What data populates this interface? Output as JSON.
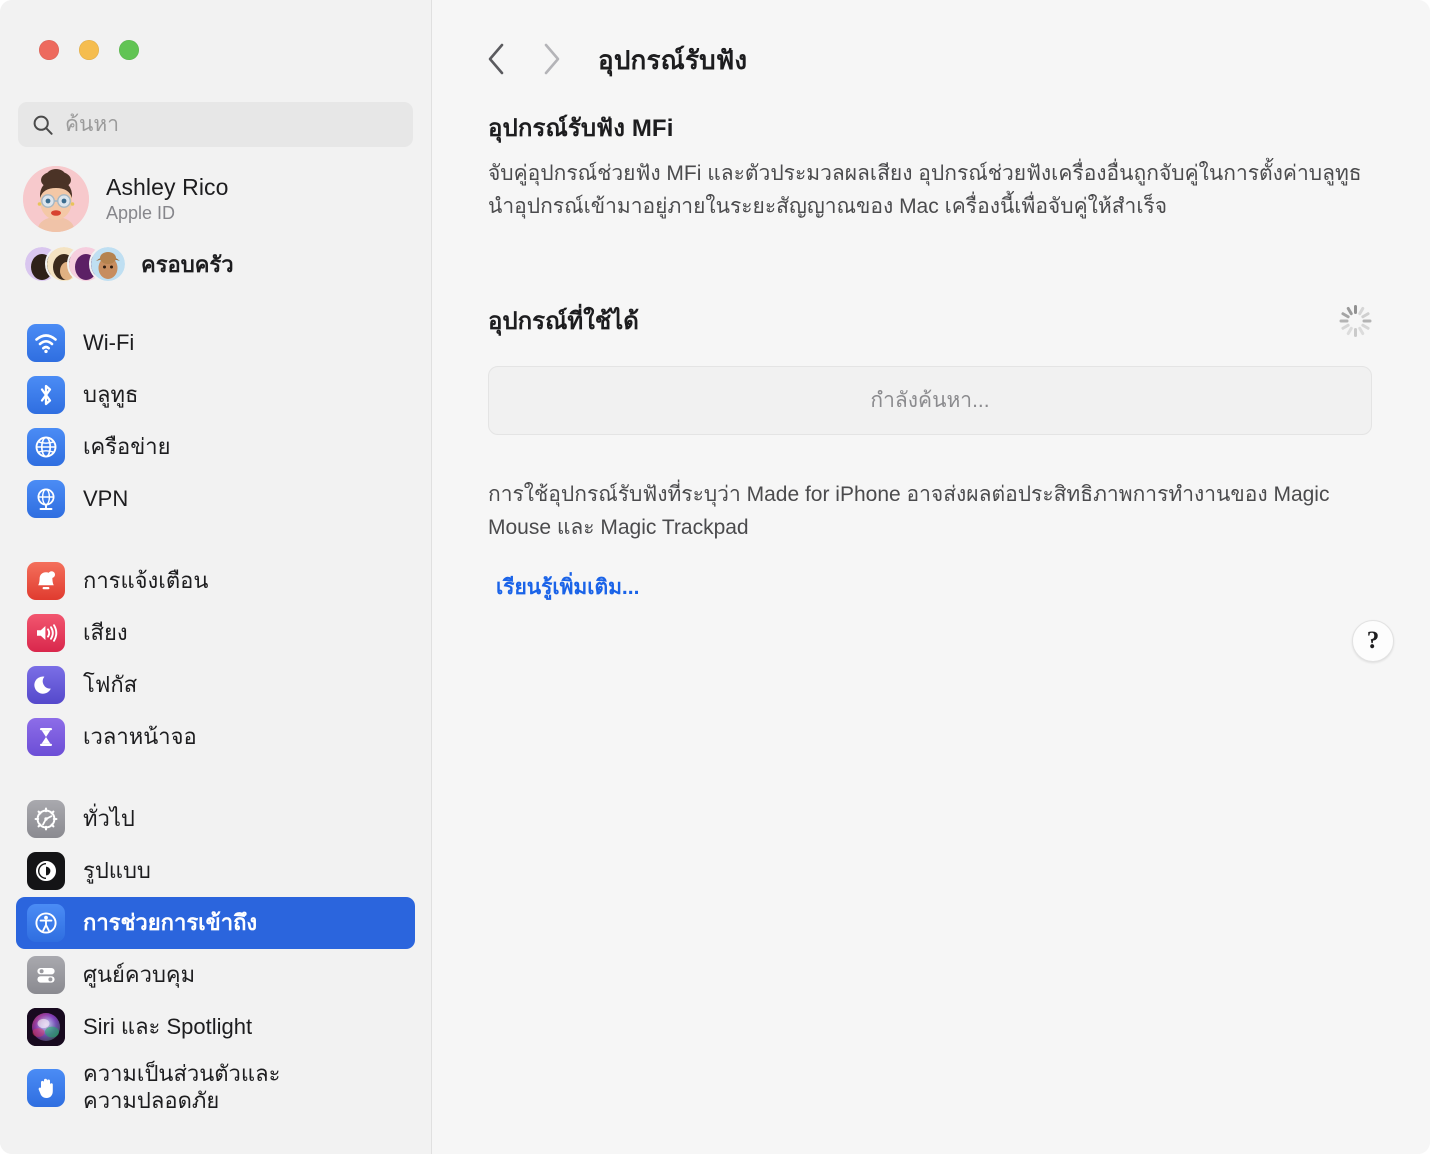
{
  "window": {
    "traffic_lights": [
      {
        "name": "close",
        "color": "#ED6A5E"
      },
      {
        "name": "minimize",
        "color": "#F5BD4F"
      },
      {
        "name": "maximize",
        "color": "#61C454"
      }
    ]
  },
  "sidebar": {
    "search": {
      "placeholder": "ค้นหา",
      "value": "",
      "icon": "search-icon"
    },
    "account": {
      "name": "Ashley Rico",
      "subtitle": "Apple ID",
      "avatar": "memoji-avatar"
    },
    "family": {
      "label": "ครอบครัว",
      "avatar_count": 4
    },
    "groups": [
      {
        "items": [
          {
            "label": "Wi-Fi",
            "icon": "wifi-icon",
            "color": "#3b7ef0",
            "selected": false
          },
          {
            "label": "บลูทูธ",
            "icon": "bluetooth-icon",
            "color": "#3b7ef0",
            "selected": false
          },
          {
            "label": "เครือข่าย",
            "icon": "globe-icon",
            "color": "#3b7ef0",
            "selected": false
          },
          {
            "label": "VPN",
            "icon": "vpn-globe-icon",
            "color": "#3b7ef0",
            "selected": false
          }
        ]
      },
      {
        "items": [
          {
            "label": "การแจ้งเตือน",
            "icon": "bell-icon",
            "color": "#ef4a3c",
            "selected": false
          },
          {
            "label": "เสียง",
            "icon": "speaker-icon",
            "color": "#e8365a",
            "selected": false
          },
          {
            "label": "โฟกัส",
            "icon": "moon-icon",
            "color": "#6458d8",
            "selected": false
          },
          {
            "label": "เวลาหน้าจอ",
            "icon": "hourglass-icon",
            "color": "#7a5ede",
            "selected": false
          }
        ]
      },
      {
        "items": [
          {
            "label": "ทั่วไป",
            "icon": "gear-icon",
            "color": "#8e8e93",
            "selected": false
          },
          {
            "label": "รูปแบบ",
            "icon": "appearance-icon",
            "color": "#1c1c1e",
            "selected": false
          },
          {
            "label": "การช่วยการเข้าถึง",
            "icon": "accessibility-icon",
            "color": "#2b65dd",
            "selected": true
          },
          {
            "label": "ศูนย์ควบคุม",
            "icon": "control-center-icon",
            "color": "#8e8e93",
            "selected": false
          },
          {
            "label": "Siri และ Spotlight",
            "icon": "siri-icon",
            "color": "#2a1630",
            "selected": false
          },
          {
            "label": "ความเป็นส่วนตัวและความปลอดภัย",
            "icon": "privacy-hand-icon",
            "color": "#3b7ef0",
            "selected": true,
            "two_line": true,
            "line1": "ความเป็นส่วนตัวและ",
            "line2": "ความปลอดภัย"
          }
        ]
      }
    ],
    "selected_accent": "#2B65DD"
  },
  "main": {
    "nav": {
      "back_icon": "chevron-left-icon",
      "forward_icon": "chevron-right-icon",
      "back_enabled": true,
      "forward_enabled": false
    },
    "title": "อุปกรณ์รับฟัง",
    "mfi_section": {
      "title": "อุปกรณ์รับฟัง MFi",
      "description": "จับคู่อุปกรณ์ช่วยฟัง MFi และตัวประมวลผลเสียง อุปกรณ์ช่วยฟังเครื่องอื่นถูกจับคู่ในการตั้งค่าบลูทูธ นำอุปกรณ์เข้ามาอยู่ภายในระยะสัญญาณของ Mac เครื่องนี้เพื่อจับคู่ให้สำเร็จ"
    },
    "available_section": {
      "title": "อุปกรณ์ที่ใช้ได้",
      "spinner_icon": "loading-spinner-icon",
      "status_text": "กำลังค้นหา..."
    },
    "footnote": "การใช้อุปกรณ์รับฟังที่ระบุว่า Made for iPhone อาจส่งผลต่อประสิทธิภาพการทำงานของ Magic Mouse และ Magic Trackpad",
    "learn_more": "เรียนรู้เพิ่มเติม...",
    "learn_more_color": "#1A63E8",
    "help_button": {
      "label": "?",
      "icon": "question-mark-icon"
    }
  }
}
